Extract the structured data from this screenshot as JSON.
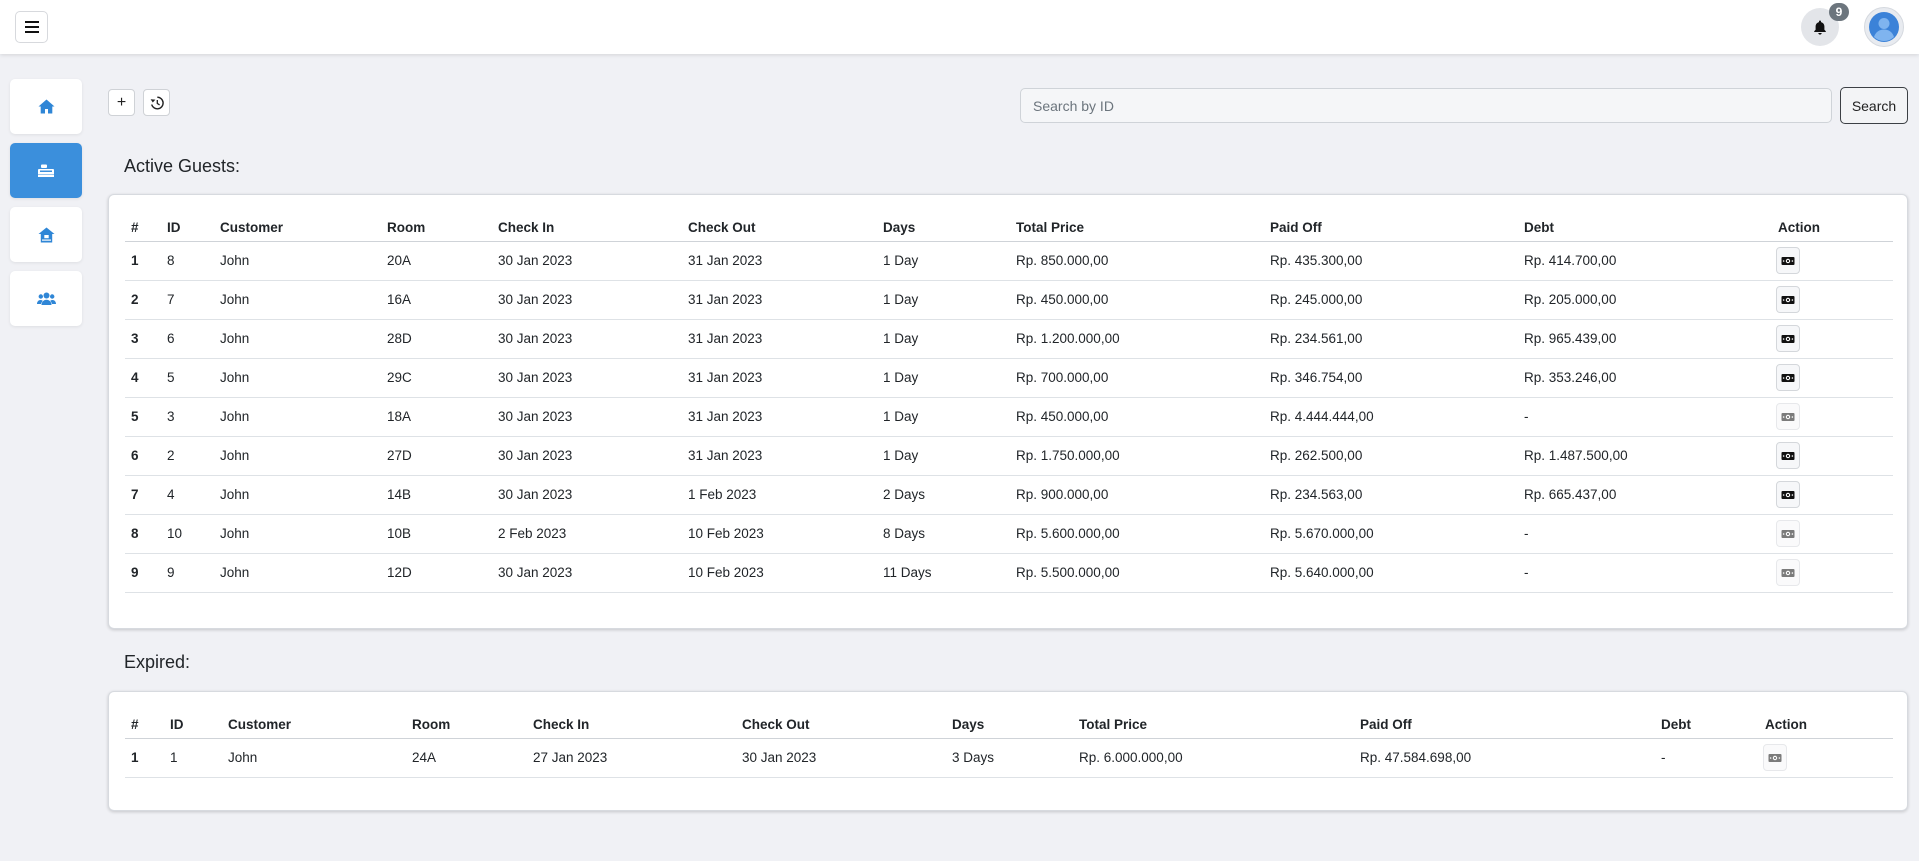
{
  "topbar": {
    "menu_icon": "hamburger-icon",
    "notification_count": "9",
    "bell_icon": "bell-icon",
    "avatar_icon": "user-avatar-icon"
  },
  "sidebar": {
    "items": [
      {
        "name": "home",
        "icon": "home-icon",
        "active": false
      },
      {
        "name": "bookings",
        "icon": "bed-icon",
        "active": true
      },
      {
        "name": "rooms",
        "icon": "house-icon",
        "active": false
      },
      {
        "name": "customers",
        "icon": "users-icon",
        "active": false
      }
    ]
  },
  "toolbar": {
    "add_label": "+",
    "history_icon": "history-icon",
    "search_placeholder": "Search by ID",
    "search_label": "Search"
  },
  "active": {
    "title": "Active Guests:",
    "headers": [
      "#",
      "ID",
      "Customer",
      "Room",
      "Check In",
      "Check Out",
      "Days",
      "Total Price",
      "Paid Off",
      "Debt",
      "Action"
    ],
    "rows": [
      {
        "n": "1",
        "id": "8",
        "customer": "John",
        "room": "20A",
        "check_in": "30 Jan 2023",
        "check_out": "31 Jan 2023",
        "days": "1 Day",
        "total": "Rp. 850.000,00",
        "paid": "Rp. 435.300,00",
        "debt": "Rp. 414.700,00",
        "payable": true
      },
      {
        "n": "2",
        "id": "7",
        "customer": "John",
        "room": "16A",
        "check_in": "30 Jan 2023",
        "check_out": "31 Jan 2023",
        "days": "1 Day",
        "total": "Rp. 450.000,00",
        "paid": "Rp. 245.000,00",
        "debt": "Rp. 205.000,00",
        "payable": true
      },
      {
        "n": "3",
        "id": "6",
        "customer": "John",
        "room": "28D",
        "check_in": "30 Jan 2023",
        "check_out": "31 Jan 2023",
        "days": "1 Day",
        "total": "Rp. 1.200.000,00",
        "paid": "Rp. 234.561,00",
        "debt": "Rp. 965.439,00",
        "payable": true
      },
      {
        "n": "4",
        "id": "5",
        "customer": "John",
        "room": "29C",
        "check_in": "30 Jan 2023",
        "check_out": "31 Jan 2023",
        "days": "1 Day",
        "total": "Rp. 700.000,00",
        "paid": "Rp. 346.754,00",
        "debt": "Rp. 353.246,00",
        "payable": true
      },
      {
        "n": "5",
        "id": "3",
        "customer": "John",
        "room": "18A",
        "check_in": "30 Jan 2023",
        "check_out": "31 Jan 2023",
        "days": "1 Day",
        "total": "Rp. 450.000,00",
        "paid": "Rp. 4.444.444,00",
        "debt": "-",
        "payable": false
      },
      {
        "n": "6",
        "id": "2",
        "customer": "John",
        "room": "27D",
        "check_in": "30 Jan 2023",
        "check_out": "31 Jan 2023",
        "days": "1 Day",
        "total": "Rp. 1.750.000,00",
        "paid": "Rp. 262.500,00",
        "debt": "Rp. 1.487.500,00",
        "payable": true
      },
      {
        "n": "7",
        "id": "4",
        "customer": "John",
        "room": "14B",
        "check_in": "30 Jan 2023",
        "check_out": "1 Feb 2023",
        "days": "2 Days",
        "total": "Rp. 900.000,00",
        "paid": "Rp. 234.563,00",
        "debt": "Rp. 665.437,00",
        "payable": true
      },
      {
        "n": "8",
        "id": "10",
        "customer": "John",
        "room": "10B",
        "check_in": "2 Feb 2023",
        "check_out": "10 Feb 2023",
        "days": "8 Days",
        "total": "Rp. 5.600.000,00",
        "paid": "Rp. 5.670.000,00",
        "debt": "-",
        "payable": false
      },
      {
        "n": "9",
        "id": "9",
        "customer": "John",
        "room": "12D",
        "check_in": "30 Jan 2023",
        "check_out": "10 Feb 2023",
        "days": "11 Days",
        "total": "Rp. 5.500.000,00",
        "paid": "Rp. 5.640.000,00",
        "debt": "-",
        "payable": false
      }
    ]
  },
  "expired": {
    "title": "Expired:",
    "headers": [
      "#",
      "ID",
      "Customer",
      "Room",
      "Check In",
      "Check Out",
      "Days",
      "Total Price",
      "Paid Off",
      "Debt",
      "Action"
    ],
    "rows": [
      {
        "n": "1",
        "id": "1",
        "customer": "John",
        "room": "24A",
        "check_in": "27 Jan 2023",
        "check_out": "30 Jan 2023",
        "days": "3 Days",
        "total": "Rp. 6.000.000,00",
        "paid": "Rp. 47.584.698,00",
        "debt": "-",
        "payable": false
      }
    ]
  },
  "colors": {
    "accent": "#3b8fdc",
    "page_bg": "#f0f1f5",
    "id_link": "#1e5aa8"
  }
}
